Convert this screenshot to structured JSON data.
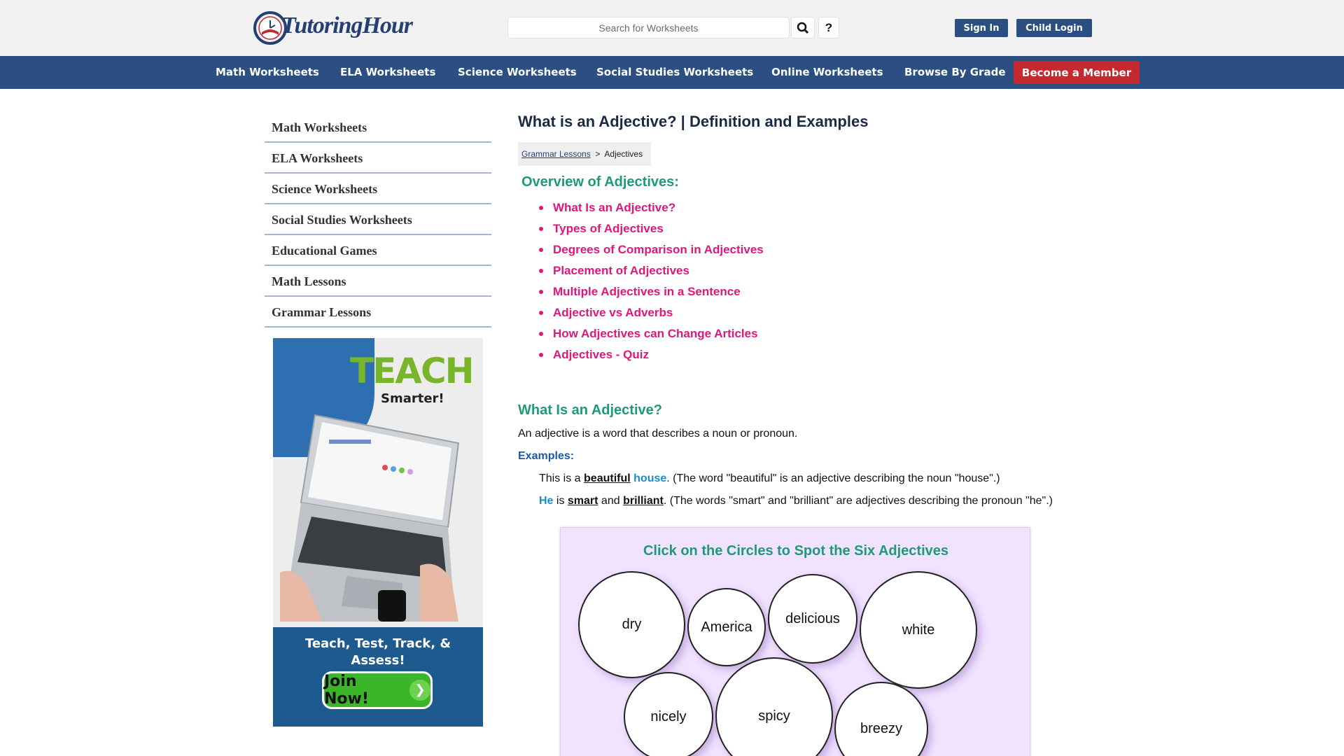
{
  "header": {
    "logo_text_a": "Tutoring",
    "logo_text_b": "Hour",
    "search_placeholder": "Search for Worksheets",
    "search_icon": "magnifier-icon",
    "help_label": "?",
    "sign_in": "Sign In",
    "child_login": "Child Login"
  },
  "nav": {
    "items": [
      "Math Worksheets",
      "ELA Worksheets",
      "Science Worksheets",
      "Social Studies Worksheets",
      "Online Worksheets",
      "Browse By Grade"
    ],
    "member": "Become a Member"
  },
  "sidebar": {
    "items": [
      "Math Worksheets",
      "ELA Worksheets",
      "Science Worksheets",
      "Social Studies Worksheets",
      "Educational Games",
      "Math Lessons",
      "Grammar Lessons"
    ]
  },
  "ad": {
    "headline": "TEACH",
    "subhead": "Smarter!",
    "tagline_1": "Teach, Test, Track, &",
    "tagline_2": "Assess!",
    "cta": "Join Now!"
  },
  "main": {
    "title": "What is an Adjective? | Definition and Examples",
    "breadcrumb": {
      "link": "Grammar Lessons",
      "sep": ">",
      "current": "Adjectives"
    },
    "overview_title": "Overview of Adjectives:",
    "toc": [
      "What Is an Adjective?",
      "Types of Adjectives",
      "Degrees of Comparison in Adjectives",
      "Placement of Adjectives",
      "Multiple Adjectives in a Sentence",
      "Adjective vs Adverbs",
      "How Adjectives can Change Articles",
      "Adjectives - Quiz"
    ],
    "section_title": "What Is an Adjective?",
    "definition": "An adjective is a word that describes a noun or pronoun.",
    "examples_label": "Examples:",
    "example1": {
      "pre": "This is a ",
      "adj": "beautiful",
      "noun": "house",
      "post": ". (The word \"beautiful\" is an adjective describing the noun \"house\".)"
    },
    "example2": {
      "pronoun": "He",
      "is": " is ",
      "adj1": "smart",
      "and": " and ",
      "adj2": "brilliant",
      "post": ". (The words \"smart\" and \"brilliant\" are adjectives describing the pronoun \"he\".)"
    }
  },
  "game": {
    "title": "Click on the Circles to Spot the Six Adjectives",
    "words": [
      "dry",
      "America",
      "delicious",
      "white",
      "nicely",
      "spicy",
      "breezy"
    ]
  }
}
